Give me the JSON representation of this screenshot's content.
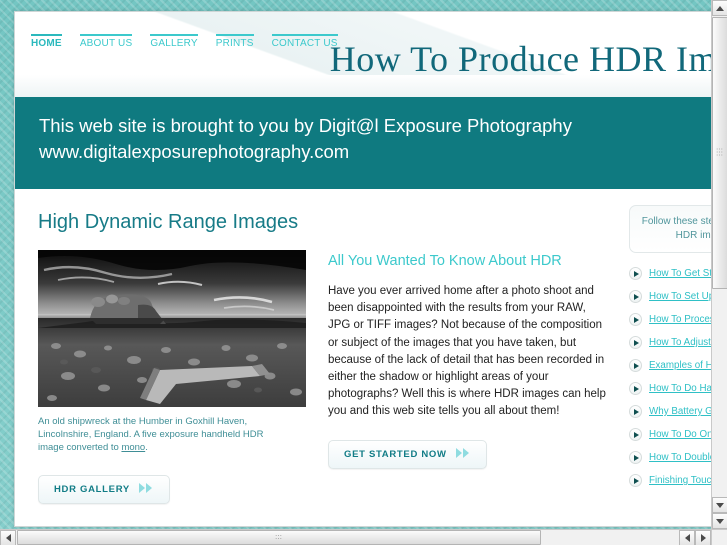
{
  "site": {
    "title": "How To Produce HDR Images",
    "nav": [
      {
        "label": "HOME",
        "active": true
      },
      {
        "label": "ABOUT US",
        "active": false
      },
      {
        "label": "GALLERY",
        "active": false
      },
      {
        "label": "PRINTS",
        "active": false
      },
      {
        "label": "CONTACT US",
        "active": false
      }
    ]
  },
  "banner": {
    "line1": "This web site is brought to you by Digit@l Exposure Photography",
    "line2": "www.digitalexposurephotography.com"
  },
  "main": {
    "heading": "High Dynamic Range Images",
    "photo": {
      "alt": "Black and white HDR photograph of an old shipwreck on a stony shore at sunset",
      "caption_line1": "An old shipwreck at the Humber in Goxhill Haven,",
      "caption_line2": "Lincolnshire, England. A five exposure handheld HDR",
      "caption_line3_pre": "image converted to ",
      "caption_link": "mono",
      "caption_line3_post": "."
    },
    "article": {
      "title": "All You Wanted To Know About HDR",
      "body": "Have you ever arrived home after a photo shoot and been disappointed with the results from your RAW, JPG or TIFF images? Not because of the composition or subject of the images that you have taken, but because of the lack of detail that has been recorded in either the shadow or highlight areas of your photographs? Well this is where HDR images can help you and this web site tells you all about them!"
    },
    "buttons": {
      "gallery_label": "HDR GALLERY",
      "started_label": "GET STARTED NOW",
      "chevron_glyph": "»"
    }
  },
  "sidebar": {
    "callout_line1": "Follow these steps to create",
    "callout_line2": "HDR images",
    "links": [
      {
        "label": "How To Get Started"
      },
      {
        "label": "How To Set Up Your Camera"
      },
      {
        "label": "How To Process Your Images"
      },
      {
        "label": "How To Adjust Your Images"
      },
      {
        "label": "Examples of HDR Images"
      },
      {
        "label": "How To Do Handheld HDR"
      },
      {
        "label": "Why Battery Grips Help"
      },
      {
        "label": "How To Do One Shot HDR"
      },
      {
        "label": "How To Double Process"
      },
      {
        "label": "Finishing Touches"
      }
    ]
  },
  "colors": {
    "brand_teal": "#0f7a80",
    "accent_cyan": "#3cc9cc",
    "heading_teal": "#177b87",
    "page_background": "#7ecbc8"
  },
  "scrollbars": {
    "vertical_up": "scroll-up",
    "vertical_down": "scroll-down",
    "horizontal_left": "scroll-left",
    "horizontal_right": "scroll-right"
  }
}
